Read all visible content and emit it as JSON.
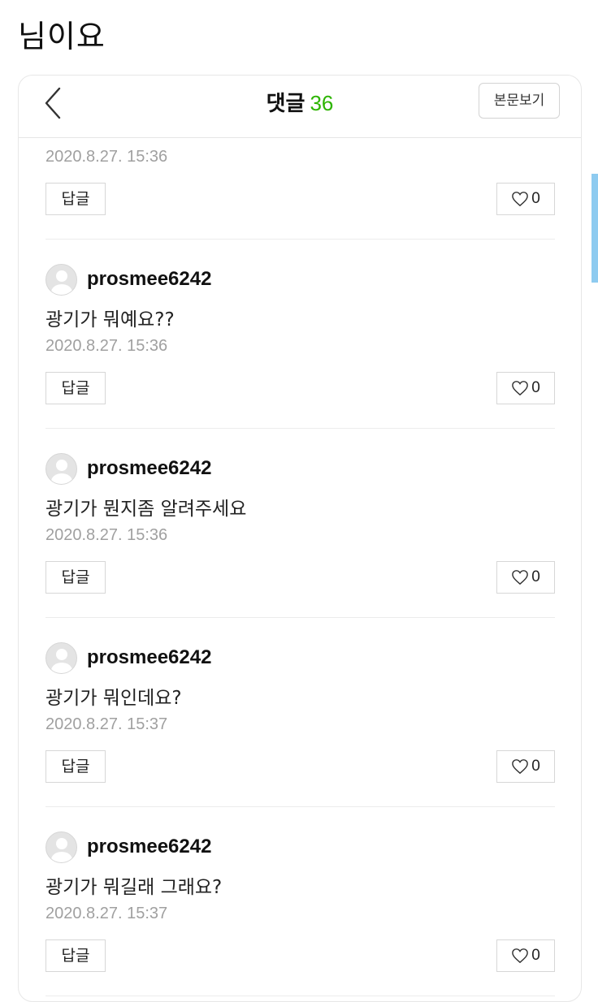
{
  "caption": "님이요",
  "header": {
    "title": "댓글",
    "count": "36",
    "view_post_label": "본문보기"
  },
  "reply_label": "답글",
  "icons": {
    "back": "chevron-left-icon",
    "like": "heart-outline-icon",
    "avatar": "default-user-avatar"
  },
  "colors": {
    "accent_green": "#2db400",
    "timestamp_gray": "#a0a0a0",
    "scroll_indicator": "#8ecbf0"
  },
  "comments": [
    {
      "author": "",
      "text": "",
      "timestamp": "2020.8.27. 15:36",
      "likes": "0"
    },
    {
      "author": "prosmee6242",
      "text": "광기가 뭐예요??",
      "timestamp": "2020.8.27. 15:36",
      "likes": "0"
    },
    {
      "author": "prosmee6242",
      "text": "광기가 뭔지좀 알려주세요",
      "timestamp": "2020.8.27. 15:36",
      "likes": "0"
    },
    {
      "author": "prosmee6242",
      "text": "광기가 뭐인데요?",
      "timestamp": "2020.8.27. 15:37",
      "likes": "0"
    },
    {
      "author": "prosmee6242",
      "text": "광기가 뭐길래 그래요?",
      "timestamp": "2020.8.27. 15:37",
      "likes": "0"
    }
  ]
}
